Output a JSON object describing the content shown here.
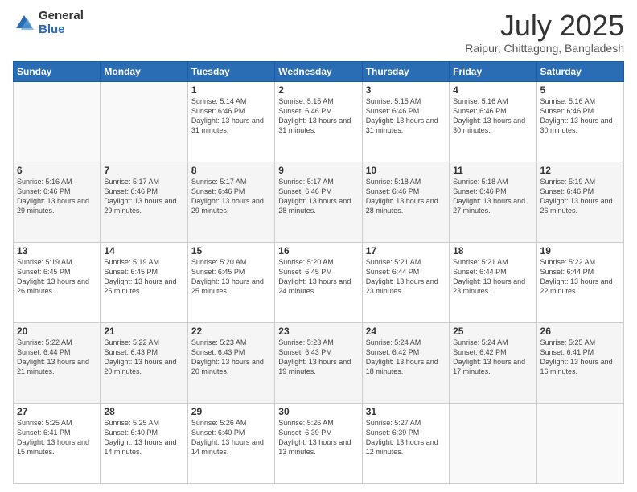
{
  "logo": {
    "general": "General",
    "blue": "Blue"
  },
  "header": {
    "title": "July 2025",
    "subtitle": "Raipur, Chittagong, Bangladesh"
  },
  "weekdays": [
    "Sunday",
    "Monday",
    "Tuesday",
    "Wednesday",
    "Thursday",
    "Friday",
    "Saturday"
  ],
  "weeks": [
    [
      {
        "day": "",
        "info": ""
      },
      {
        "day": "",
        "info": ""
      },
      {
        "day": "1",
        "info": "Sunrise: 5:14 AM\nSunset: 6:46 PM\nDaylight: 13 hours and 31 minutes."
      },
      {
        "day": "2",
        "info": "Sunrise: 5:15 AM\nSunset: 6:46 PM\nDaylight: 13 hours and 31 minutes."
      },
      {
        "day": "3",
        "info": "Sunrise: 5:15 AM\nSunset: 6:46 PM\nDaylight: 13 hours and 31 minutes."
      },
      {
        "day": "4",
        "info": "Sunrise: 5:16 AM\nSunset: 6:46 PM\nDaylight: 13 hours and 30 minutes."
      },
      {
        "day": "5",
        "info": "Sunrise: 5:16 AM\nSunset: 6:46 PM\nDaylight: 13 hours and 30 minutes."
      }
    ],
    [
      {
        "day": "6",
        "info": "Sunrise: 5:16 AM\nSunset: 6:46 PM\nDaylight: 13 hours and 29 minutes."
      },
      {
        "day": "7",
        "info": "Sunrise: 5:17 AM\nSunset: 6:46 PM\nDaylight: 13 hours and 29 minutes."
      },
      {
        "day": "8",
        "info": "Sunrise: 5:17 AM\nSunset: 6:46 PM\nDaylight: 13 hours and 29 minutes."
      },
      {
        "day": "9",
        "info": "Sunrise: 5:17 AM\nSunset: 6:46 PM\nDaylight: 13 hours and 28 minutes."
      },
      {
        "day": "10",
        "info": "Sunrise: 5:18 AM\nSunset: 6:46 PM\nDaylight: 13 hours and 28 minutes."
      },
      {
        "day": "11",
        "info": "Sunrise: 5:18 AM\nSunset: 6:46 PM\nDaylight: 13 hours and 27 minutes."
      },
      {
        "day": "12",
        "info": "Sunrise: 5:19 AM\nSunset: 6:46 PM\nDaylight: 13 hours and 26 minutes."
      }
    ],
    [
      {
        "day": "13",
        "info": "Sunrise: 5:19 AM\nSunset: 6:45 PM\nDaylight: 13 hours and 26 minutes."
      },
      {
        "day": "14",
        "info": "Sunrise: 5:19 AM\nSunset: 6:45 PM\nDaylight: 13 hours and 25 minutes."
      },
      {
        "day": "15",
        "info": "Sunrise: 5:20 AM\nSunset: 6:45 PM\nDaylight: 13 hours and 25 minutes."
      },
      {
        "day": "16",
        "info": "Sunrise: 5:20 AM\nSunset: 6:45 PM\nDaylight: 13 hours and 24 minutes."
      },
      {
        "day": "17",
        "info": "Sunrise: 5:21 AM\nSunset: 6:44 PM\nDaylight: 13 hours and 23 minutes."
      },
      {
        "day": "18",
        "info": "Sunrise: 5:21 AM\nSunset: 6:44 PM\nDaylight: 13 hours and 23 minutes."
      },
      {
        "day": "19",
        "info": "Sunrise: 5:22 AM\nSunset: 6:44 PM\nDaylight: 13 hours and 22 minutes."
      }
    ],
    [
      {
        "day": "20",
        "info": "Sunrise: 5:22 AM\nSunset: 6:44 PM\nDaylight: 13 hours and 21 minutes."
      },
      {
        "day": "21",
        "info": "Sunrise: 5:22 AM\nSunset: 6:43 PM\nDaylight: 13 hours and 20 minutes."
      },
      {
        "day": "22",
        "info": "Sunrise: 5:23 AM\nSunset: 6:43 PM\nDaylight: 13 hours and 20 minutes."
      },
      {
        "day": "23",
        "info": "Sunrise: 5:23 AM\nSunset: 6:43 PM\nDaylight: 13 hours and 19 minutes."
      },
      {
        "day": "24",
        "info": "Sunrise: 5:24 AM\nSunset: 6:42 PM\nDaylight: 13 hours and 18 minutes."
      },
      {
        "day": "25",
        "info": "Sunrise: 5:24 AM\nSunset: 6:42 PM\nDaylight: 13 hours and 17 minutes."
      },
      {
        "day": "26",
        "info": "Sunrise: 5:25 AM\nSunset: 6:41 PM\nDaylight: 13 hours and 16 minutes."
      }
    ],
    [
      {
        "day": "27",
        "info": "Sunrise: 5:25 AM\nSunset: 6:41 PM\nDaylight: 13 hours and 15 minutes."
      },
      {
        "day": "28",
        "info": "Sunrise: 5:25 AM\nSunset: 6:40 PM\nDaylight: 13 hours and 14 minutes."
      },
      {
        "day": "29",
        "info": "Sunrise: 5:26 AM\nSunset: 6:40 PM\nDaylight: 13 hours and 14 minutes."
      },
      {
        "day": "30",
        "info": "Sunrise: 5:26 AM\nSunset: 6:39 PM\nDaylight: 13 hours and 13 minutes."
      },
      {
        "day": "31",
        "info": "Sunrise: 5:27 AM\nSunset: 6:39 PM\nDaylight: 13 hours and 12 minutes."
      },
      {
        "day": "",
        "info": ""
      },
      {
        "day": "",
        "info": ""
      }
    ]
  ]
}
